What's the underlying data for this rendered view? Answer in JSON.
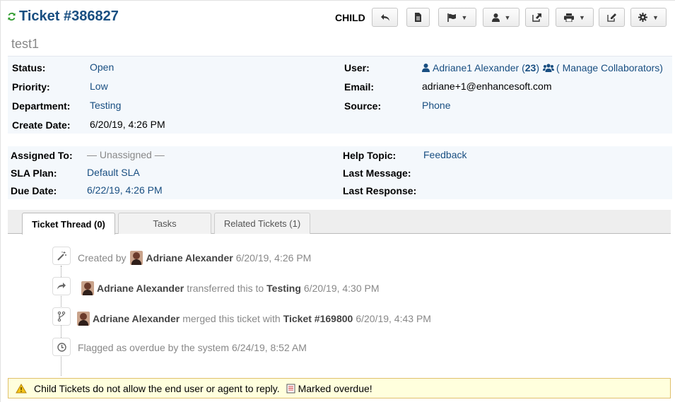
{
  "header": {
    "title": "Ticket #386827",
    "subject": "test1",
    "child_label": "CHILD"
  },
  "toolbar": {
    "buttons": [
      "back-icon",
      "pdf-icon",
      "flag-icon",
      "user-icon",
      "transfer-icon",
      "print-icon",
      "edit-icon",
      "gear-icon"
    ]
  },
  "info": {
    "status_label": "Status:",
    "status": "Open",
    "priority_label": "Priority:",
    "priority": "Low",
    "department_label": "Department:",
    "department": "Testing",
    "create_date_label": "Create Date:",
    "create_date": "6/20/19, 4:26 PM",
    "user_label": "User:",
    "user_name": "Adriane1 Alexander (",
    "user_count": "23",
    "user_close": ")",
    "collaborators": "( Manage Collaborators)",
    "email_label": "Email:",
    "email": "adriane+1@enhancesoft.com",
    "source_label": "Source:",
    "source": "Phone"
  },
  "assignment": {
    "assigned_label": "Assigned To:",
    "assigned": "— Unassigned —",
    "sla_label": "SLA Plan:",
    "sla": "Default SLA",
    "due_label": "Due Date:",
    "due": "6/22/19, 4:26 PM",
    "help_topic_label": "Help Topic:",
    "help_topic": "Feedback",
    "last_message_label": "Last Message:",
    "last_response_label": "Last Response:"
  },
  "tabs": [
    {
      "label": "Ticket Thread (0)"
    },
    {
      "label": "Tasks"
    },
    {
      "label": "Related Tickets (1)"
    }
  ],
  "thread": {
    "e1": {
      "prefix": "Created by",
      "user": "Adriane Alexander",
      "time": "6/20/19, 4:26 PM"
    },
    "e2": {
      "user": "Adriane Alexander",
      "action": "transferred this to",
      "target": "Testing",
      "time": "6/20/19, 4:30 PM"
    },
    "e3": {
      "user": "Adriane Alexander",
      "action": "merged this ticket with",
      "target": "Ticket #169800",
      "time": "6/20/19, 4:43 PM"
    },
    "e4": {
      "text": "Flagged as overdue by the system",
      "time": "6/24/19, 8:52 AM"
    }
  },
  "notice": {
    "text": "Child Tickets do not allow the end user or agent to reply.",
    "overdue": "Marked overdue!"
  },
  "colors": {
    "link": "#184e81",
    "panel": "#f4f8fc",
    "notice_bg": "#ffffdd",
    "refresh": "#2e9b2e"
  }
}
